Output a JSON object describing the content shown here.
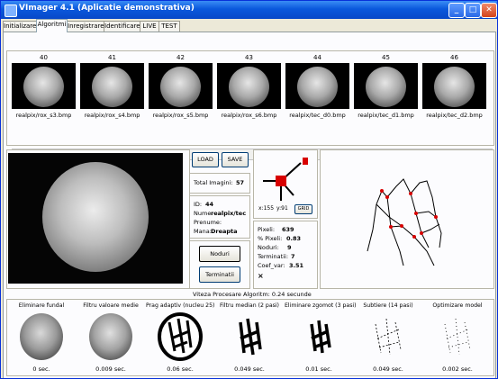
{
  "window": {
    "title": "VImager 4.1 (Aplicatie demonstrativa)",
    "controls": [
      "_",
      "□",
      "✕"
    ]
  },
  "tabs": [
    "Initializare",
    "Algoritmi",
    "Inregistrare",
    "Identificare",
    "LIVE",
    "TEST"
  ],
  "active_tab": "Algoritmi",
  "thumbnails": [
    {
      "num": "40",
      "file": "realpix/rox_s3.bmp"
    },
    {
      "num": "41",
      "file": "realpix/rox_s4.bmp"
    },
    {
      "num": "42",
      "file": "realpix/rox_s5.bmp"
    },
    {
      "num": "43",
      "file": "realpix/rox_s6.bmp"
    },
    {
      "num": "44",
      "file": "realpix/tec_d0.bmp"
    },
    {
      "num": "45",
      "file": "realpix/tec_d1.bmp"
    },
    {
      "num": "46",
      "file": "realpix/tec_d2.bmp"
    }
  ],
  "scroll": {
    "left": "◄",
    "right": "►"
  },
  "buttons": {
    "load": "LOAD",
    "save": "SAVE",
    "noduri": "Noduri",
    "terminatii": "Terminatii",
    "grid": "GRID"
  },
  "total": {
    "label": "Total Imagini:",
    "value": "57"
  },
  "person": {
    "id_label": "ID:",
    "id": "44",
    "nume_label": "Nume:",
    "nume": "realpix/tec",
    "prenume_label": "Prenume:",
    "prenume": "",
    "mana_label": "Mana:",
    "mana": "Dreapta"
  },
  "zoom": {
    "x": "x:155",
    "y": "y:91"
  },
  "stats": [
    {
      "label": "Pixeli:",
      "value": "639"
    },
    {
      "label": "% Pixeli:",
      "value": "0.83"
    },
    {
      "label": "Noduri:",
      "value": "9"
    },
    {
      "label": "Terminatii:",
      "value": "7"
    },
    {
      "label": "Coef_var:",
      "value": "3.51"
    },
    {
      "label": "×",
      "value": ""
    }
  ],
  "speed": "Viteza Procesare Algoritm: 0.24 secunde",
  "steps": [
    {
      "label": "Eliminare fundal",
      "time": "0 sec."
    },
    {
      "label": "Filtru valoare medie",
      "time": "0.009 sec."
    },
    {
      "label": "Prag adaptiv (nucleu 25)",
      "time": "0.06 sec."
    },
    {
      "label": "Filtru median (2 pasi)",
      "time": "0.049 sec."
    },
    {
      "label": "Eliminare zgomot (3 pasi)",
      "time": "0.01 sec."
    },
    {
      "label": "Subtiere (14 pasi)",
      "time": "0.049 sec."
    },
    {
      "label": "Optimizare model",
      "time": "0.002 sec."
    }
  ],
  "colors": {
    "titlebar": "#0a58dc",
    "node": "#d80000",
    "grid_marker": "#d80000"
  }
}
